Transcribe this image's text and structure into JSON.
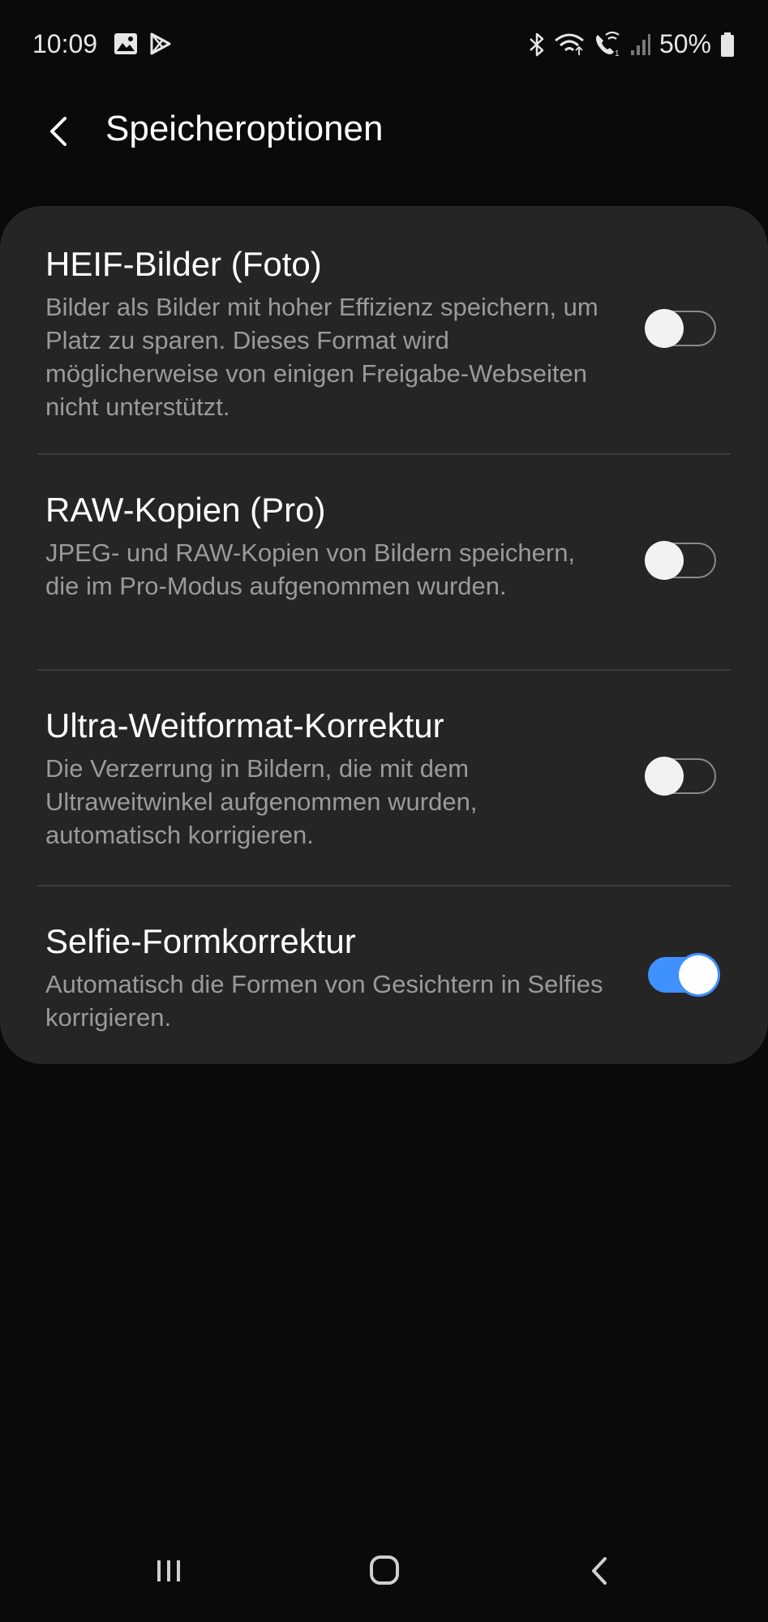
{
  "status_bar": {
    "time": "10:09",
    "battery_text": "50%",
    "left_icons": [
      "gallery-icon",
      "play-store-icon"
    ],
    "right_icons": [
      "bluetooth-icon",
      "wifi-icon",
      "wifi-call-icon",
      "signal-icon",
      "battery-icon"
    ]
  },
  "header": {
    "title": "Speicheroptionen",
    "back_icon": "chevron-left-icon"
  },
  "settings": [
    {
      "title": "HEIF-Bilder (Foto)",
      "description": "Bilder als Bilder mit hoher Effizienz speichern, um Platz zu sparen. Dieses Format wird möglicherweise von einigen Freigabe-Webseiten nicht unterstützt.",
      "enabled": false
    },
    {
      "title": "RAW-Kopien (Pro)",
      "description": "JPEG- und RAW-Kopien von Bildern speichern, die im Pro-Modus aufgenommen wurden.",
      "enabled": false
    },
    {
      "title": "Ultra-Weitformat-Korrektur",
      "description": "Die Verzerrung in Bildern, die mit dem Ultraweitwinkel aufgenommen wurden, automatisch korrigieren.",
      "enabled": false
    },
    {
      "title": "Selfie-Formkorrektur",
      "description": "Automatisch die Formen von Gesichtern in Selfies korrigieren.",
      "enabled": true
    }
  ],
  "nav_bar": {
    "icons": [
      "recent-apps-icon",
      "home-icon",
      "back-icon"
    ]
  },
  "colors": {
    "background": "#0a0a0a",
    "card": "#252525",
    "accent": "#3e91ff",
    "secondary_text": "#9a9a9a"
  }
}
